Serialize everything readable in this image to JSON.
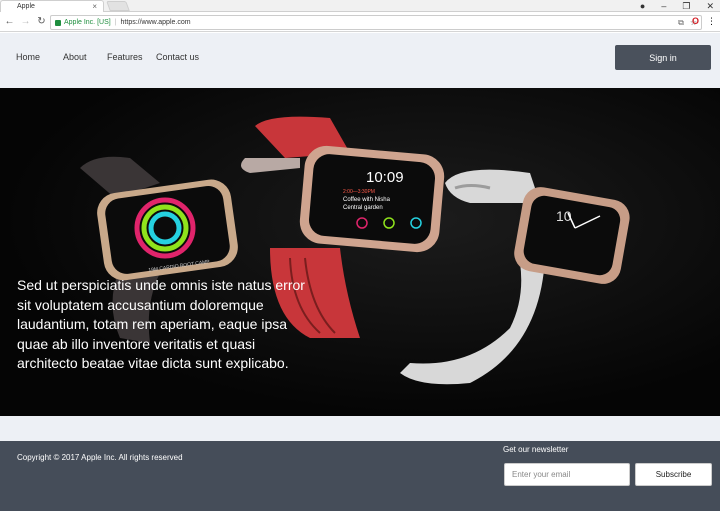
{
  "browser": {
    "tab_title": "Apple",
    "secure_label": "Apple Inc. [US]",
    "url": "https://www.apple.com"
  },
  "nav": {
    "home": "Home",
    "about": "About",
    "features": "Features",
    "contact": "Contact us",
    "sign_in": "Sign in"
  },
  "hero": {
    "text": "Sed ut perspiciatis unde omnis iste natus error sit voluptatem accusantium doloremque laudantium, totam rem aperiam, eaque ipsa quae ab illo inventore veritatis et quasi architecto beatae vitae dicta sunt explicabo.",
    "watch_center_time": "10:09",
    "watch_center_event_time": "2:00—3:30PM",
    "watch_center_event": "Coffee with Nisha",
    "watch_center_event_place": "Central garden",
    "watch_left_label": "19M CARDIO BOOT CAMP",
    "watch_right_numeral": "10"
  },
  "footer": {
    "copyright": "Copyright © 2017 Apple Inc. All rights reserved",
    "newsletter_title": "Get our newsletter",
    "email_placeholder": "Enter your email",
    "subscribe": "Subscribe"
  },
  "colors": {
    "nav_bg": "#edf0f5",
    "button_dark": "#4a515c",
    "footer_bg": "#454d59",
    "watch_band_red": "#c8363a"
  }
}
